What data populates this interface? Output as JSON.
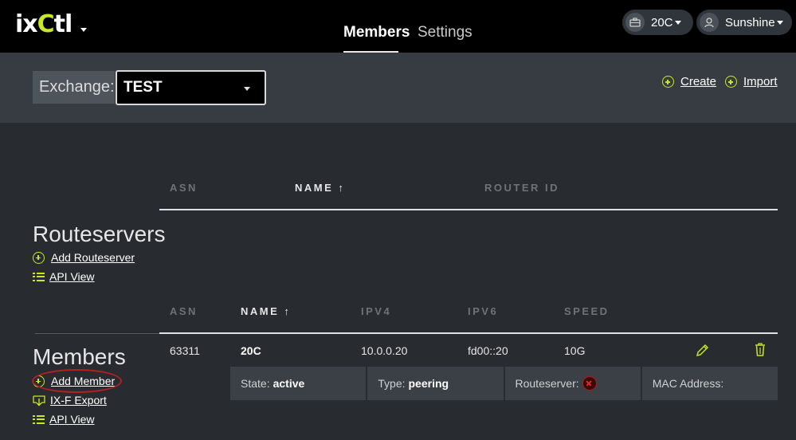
{
  "app": {
    "logo_part1": "ix",
    "logo_part2": "C",
    "logo_part3": "tl"
  },
  "nav": {
    "tabs": [
      {
        "label": "Members"
      },
      {
        "label": "Settings"
      }
    ]
  },
  "org_menu": {
    "label": "20C",
    "icon": "briefcase-icon"
  },
  "user_menu": {
    "label": "Sunshine",
    "icon": "user-icon"
  },
  "exchange": {
    "label": "Exchange:",
    "selected": "TEST"
  },
  "actions": {
    "create": "Create",
    "import": "Import"
  },
  "routeservers": {
    "title": "Routeservers",
    "add_link": "Add Routeserver",
    "api_link": "API View",
    "columns": [
      "ASN",
      "NAME ↑",
      "ROUTER ID"
    ]
  },
  "members": {
    "title": "Members",
    "add_link": "Add Member",
    "export_link": "IX-F Export",
    "api_link": "API View",
    "columns": [
      "ASN",
      "NAME ↑",
      "IPV4",
      "IPV6",
      "SPEED"
    ],
    "rows": [
      {
        "asn": "63311",
        "name": "20C",
        "ipv4": "10.0.0.20",
        "ipv6": "fd00::20",
        "speed": "10G",
        "details": {
          "state_label": "State:",
          "state": "active",
          "type_label": "Type:",
          "type": "peering",
          "routeserver_label": "Routeserver:",
          "mac_label": "MAC Address:"
        }
      }
    ]
  },
  "colors": {
    "accent": "#c8e62a",
    "highlight_circle": "#b22020",
    "bg": "#282c30",
    "topbar": "#000000"
  }
}
